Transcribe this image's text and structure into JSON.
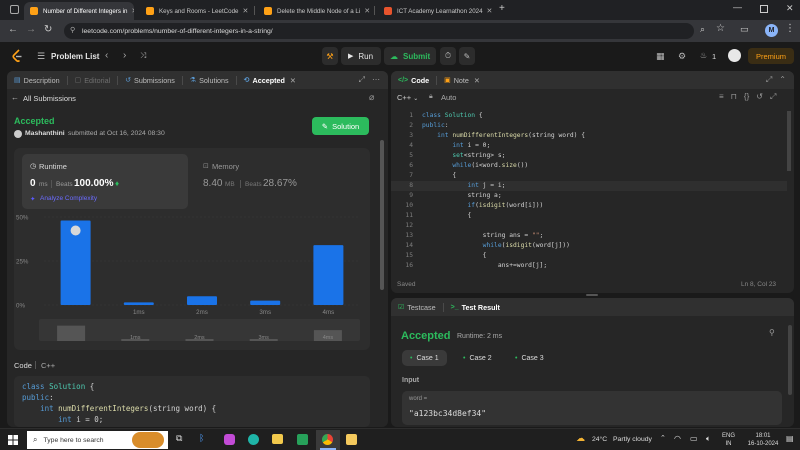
{
  "browser": {
    "tabs": [
      {
        "label": "Number of Different Integers in",
        "active": true
      },
      {
        "label": "Keys and Rooms - LeetCode",
        "active": false
      },
      {
        "label": "Delete the Middle Node of a Li",
        "active": false
      },
      {
        "label": "ICT Academy Learnathon 2024",
        "active": false
      }
    ],
    "url": "leetcode.com/problems/number-of-different-integers-in-a-string/",
    "profile_initial": "M"
  },
  "nav": {
    "problem_list": "Problem List",
    "run": "Run",
    "submit": "Submit",
    "streak": "1",
    "premium": "Premium"
  },
  "left_tabs": {
    "description": "Description",
    "editorial": "Editorial",
    "submissions": "Submissions",
    "solutions": "Solutions",
    "accepted": "Accepted"
  },
  "submission": {
    "all_submissions": "All Submissions",
    "status": "Accepted",
    "author": "Mashanthini",
    "submitted_at": "submitted at Oct 16, 2024 08:30",
    "solution_button": "Solution",
    "runtime_label": "Runtime",
    "runtime_value": "0",
    "runtime_unit": "ms",
    "beats_label": "Beats",
    "beats_runtime": "100.00%",
    "analyze": "Analyze Complexity",
    "memory_label": "Memory",
    "memory_value": "8.40",
    "memory_unit": "MB",
    "beats_memory": "28.67%"
  },
  "chart_data": {
    "type": "bar",
    "categories": [
      "0ms",
      "1ms",
      "2ms",
      "3ms",
      "4ms"
    ],
    "x_tick_labels": [
      "",
      "1ms",
      "2ms",
      "3ms",
      "4ms"
    ],
    "values": [
      48,
      1.5,
      5,
      2.5,
      34
    ],
    "ylim": [
      0,
      50
    ],
    "y_ticks": [
      "50%",
      "25%",
      "0%"
    ],
    "y_tick_values": [
      50,
      25,
      0
    ],
    "highlight_index": 0,
    "bar_color": "#1a73e8",
    "minimap_labels": [
      "",
      "1ms",
      "2ms",
      "3ms",
      "4ms"
    ]
  },
  "left_code": {
    "lang_label": "Code",
    "lang": "C++",
    "lines": [
      [
        [
          "kw",
          "class "
        ],
        [
          "ty",
          "Solution "
        ],
        [
          "",
          "{"
        ]
      ],
      [
        [
          "kw",
          "public"
        ],
        [
          "",
          ":"
        ]
      ],
      [
        [
          "",
          "    "
        ],
        [
          "kw",
          "int "
        ],
        [
          "fn",
          "numDifferentIntegers"
        ],
        [
          "",
          "(string word) {"
        ]
      ],
      [
        [
          "",
          "        "
        ],
        [
          "kw",
          "int "
        ],
        [
          "",
          "i = 0;"
        ]
      ]
    ]
  },
  "editor": {
    "tab_code": "Code",
    "tab_note": "Note",
    "lang": "C++",
    "mode": "Auto",
    "saved": "Saved",
    "cursor_pos": "Ln 8, Col 23",
    "lines": [
      {
        "n": "1",
        "segs": [
          [
            "kw",
            "class "
          ],
          [
            "ty",
            "Solution "
          ],
          [
            "",
            "{"
          ]
        ]
      },
      {
        "n": "2",
        "segs": [
          [
            "kw",
            "public"
          ],
          [
            "",
            ":"
          ]
        ]
      },
      {
        "n": "3",
        "segs": [
          [
            "",
            "    "
          ],
          [
            "kw",
            "int "
          ],
          [
            "fn",
            "numDifferentIntegers"
          ],
          [
            "",
            "(string word) {"
          ]
        ]
      },
      {
        "n": "4",
        "segs": [
          [
            "",
            "        "
          ],
          [
            "kw",
            "int "
          ],
          [
            "",
            "i = 0;"
          ]
        ]
      },
      {
        "n": "5",
        "segs": [
          [
            "",
            "        "
          ],
          [
            "ty",
            "set"
          ],
          [
            "",
            "<string> s;"
          ]
        ]
      },
      {
        "n": "6",
        "segs": [
          [
            "",
            "        "
          ],
          [
            "kw",
            "while"
          ],
          [
            "",
            "(i<word."
          ],
          [
            "fn",
            "size"
          ],
          [
            "",
            "())"
          ]
        ]
      },
      {
        "n": "7",
        "segs": [
          [
            "",
            "        {"
          ]
        ]
      },
      {
        "n": "8",
        "segs": [
          [
            "",
            "            "
          ],
          [
            "kw",
            "int "
          ],
          [
            "",
            "j = i;"
          ]
        ]
      },
      {
        "n": "9",
        "segs": [
          [
            "",
            "            string a;"
          ]
        ]
      },
      {
        "n": "10",
        "segs": [
          [
            "",
            "            "
          ],
          [
            "kw",
            "if"
          ],
          [
            "",
            "("
          ],
          [
            "fn",
            "isdigit"
          ],
          [
            "",
            "(word[i]))"
          ]
        ]
      },
      {
        "n": "11",
        "segs": [
          [
            "",
            "            {"
          ]
        ]
      },
      {
        "n": "12",
        "segs": [
          [
            "",
            ""
          ]
        ]
      },
      {
        "n": "13",
        "segs": [
          [
            "",
            "                string ans = "
          ],
          [
            "st",
            "\"\""
          ],
          [
            "",
            ";"
          ]
        ]
      },
      {
        "n": "14",
        "segs": [
          [
            "",
            "                "
          ],
          [
            "kw",
            "while"
          ],
          [
            "",
            "("
          ],
          [
            "fn",
            "isdigit"
          ],
          [
            "",
            "(word[j]))"
          ]
        ]
      },
      {
        "n": "15",
        "segs": [
          [
            "",
            "                {"
          ]
        ]
      },
      {
        "n": "16",
        "segs": [
          [
            "",
            "                    ans+=word[j];"
          ]
        ]
      }
    ]
  },
  "result": {
    "tab_testcase": "Testcase",
    "tab_result": "Test Result",
    "status": "Accepted",
    "runtime": "Runtime: 2 ms",
    "cases": [
      "Case 1",
      "Case 2",
      "Case 3"
    ],
    "input_label": "Input",
    "var_name": "word =",
    "var_value": "\"a123bc34d8ef34\""
  },
  "taskbar": {
    "search_placeholder": "Type here to search",
    "weather_temp": "24°C",
    "weather_text": "Partly cloudy",
    "lang": "ENG",
    "lang_region": "IN",
    "time": "18:01",
    "date": "16-10-2024"
  },
  "colors": {
    "accepted": "#2cbb5d",
    "blue": "#1a73e8",
    "premium": "#ffa116",
    "panel": "#262626"
  }
}
